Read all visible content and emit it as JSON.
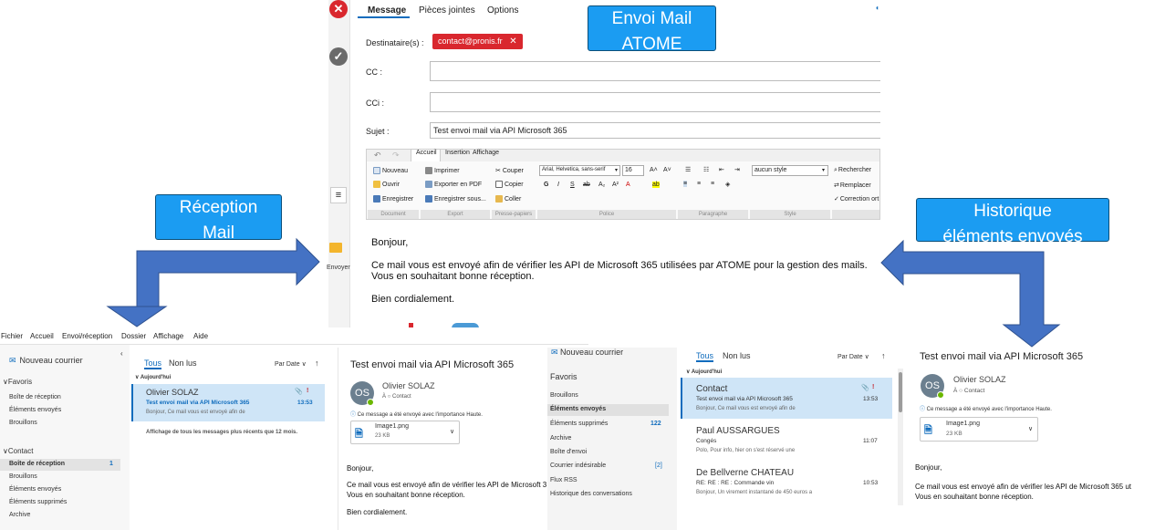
{
  "compose": {
    "tabs": [
      "Message",
      "Pièces jointes",
      "Options"
    ],
    "to_label": "Destinataire(s) :",
    "to_chip": "contact@pronis.fr",
    "cc_label": "CC :",
    "cci_label": "CCi :",
    "subject_label": "Sujet :",
    "subject_value": "Test envoi mail via API Microsoft 365",
    "send_label": "Envoyer",
    "ribbon_tabs": [
      "Accueil",
      "Insertion",
      "Affichage"
    ],
    "ribbon": {
      "nouveau": "Nouveau",
      "ouvrir": "Ouvrir",
      "enregistrer": "Enregistrer",
      "imprimer": "Imprimer",
      "exporter_pdf": "Exporter en PDF",
      "enregistrer_sous": "Enregistrer sous...",
      "couper": "Couper",
      "copier": "Copier",
      "coller": "Coller",
      "font": "Arial, Helvetica, sans-serif",
      "size": "16",
      "style": "aucun style",
      "rechercher": "Rechercher",
      "remplacer": "Remplacer",
      "correction": "Correction ort"
    },
    "groups": [
      "Document",
      "Export",
      "Presse-papiers",
      "Police",
      "Paragraphe",
      "Style"
    ],
    "body": {
      "greeting": "Bonjour,",
      "line1": "Ce mail vous est envoyé afin de vérifier les API de Microsoft 365 utilisées par ATOME pour la gestion des mails.",
      "line2": "Vous en souhaitant bonne réception.",
      "closing": "Bien cordialement."
    }
  },
  "callouts": {
    "envoi": [
      "Envoi Mail",
      "ATOME"
    ],
    "reception": [
      "Réception",
      "Mail"
    ],
    "historique": [
      "Historique",
      "éléments envoyés"
    ]
  },
  "inbox": {
    "menu": [
      "Fichier",
      "Accueil",
      "Envoi/réception",
      "Dossier",
      "Affichage",
      "Aide"
    ],
    "new_mail": "Nouveau courrier",
    "favoris": "Favoris",
    "fav_items": [
      "Boîte de réception",
      "Éléments envoyés",
      "Brouillons"
    ],
    "contact": "Contact",
    "contact_items": [
      "Boîte de réception",
      "Brouillons",
      "Éléments envoyés",
      "Éléments supprimés",
      "Archive"
    ],
    "inbox_count": "1",
    "tab_all": "Tous",
    "tab_unread": "Non lus",
    "sort": "Par Date",
    "group_today": "Aujourd'hui",
    "msg": {
      "from": "Olivier SOLAZ",
      "subject": "Test envoi mail via API Microsoft 365",
      "time": "13:53",
      "preview": "Bonjour,   Ce mail vous est envoyé afin de"
    },
    "older_notice": "Affichage de tous les messages plus récents que 12 mois.",
    "reading": {
      "title": "Test envoi mail via API Microsoft 365",
      "from": "Olivier SOLAZ",
      "initials": "OS",
      "to_prefix": "À",
      "to": "Contact",
      "importance": "Ce message a été envoyé avec l'importance Haute.",
      "attachment": "Image1.png",
      "att_size": "23 KB",
      "greeting": "Bonjour,",
      "line1": "Ce mail vous est envoyé afin de vérifier les API de Microsoft 3",
      "line2": "Vous en souhaitant bonne réception.",
      "closing": "Bien cordialement."
    }
  },
  "sent": {
    "new_mail": "Nouveau courrier",
    "favoris": "Favoris",
    "folders": [
      "Brouillons",
      "Éléments envoyés",
      "Éléments supprimés",
      "Archive",
      "Boîte d'envoi",
      "Courrier indésirable",
      "Flux RSS",
      "Historique des conversations"
    ],
    "deleted_count": "122",
    "junk_count": "[2]",
    "tab_all": "Tous",
    "tab_unread": "Non lus",
    "sort": "Par Date",
    "group_today": "Aujourd'hui",
    "messages": [
      {
        "from": "Contact",
        "subject": "Test envoi mail via API Microsoft 365",
        "time": "13:53",
        "preview": "Bonjour,   Ce mail vous est envoyé afin de"
      },
      {
        "from": "Paul AUSSARGUES",
        "subject": "Congés",
        "time": "11:07",
        "preview": "Polo,  Pour info, hier on s'est réservé une"
      },
      {
        "from": "De Bellverne CHATEAU",
        "subject": "RE: RE : RE : Commande vin",
        "time": "10:53",
        "preview": "Bonjour,  Un virement instantané de 450 euros a"
      }
    ],
    "reading": {
      "title": "Test envoi mail via API Microsoft 365",
      "from": "Olivier SOLAZ",
      "initials": "OS",
      "to_prefix": "À",
      "to": "Contact",
      "importance": "Ce message a été envoyé avec l'importance Haute.",
      "attachment": "Image1.png",
      "att_size": "23 KB",
      "greeting": "Bonjour,",
      "line1": "Ce mail vous est envoyé afin de vérifier les API de Microsoft 365 ut",
      "line2": "Vous en souhaitant bonne réception."
    }
  },
  "colors": {
    "callout": "#1b9cf2",
    "arrow": "#4472c4",
    "selected": "#cfe5f7",
    "chip": "#d9272e"
  }
}
